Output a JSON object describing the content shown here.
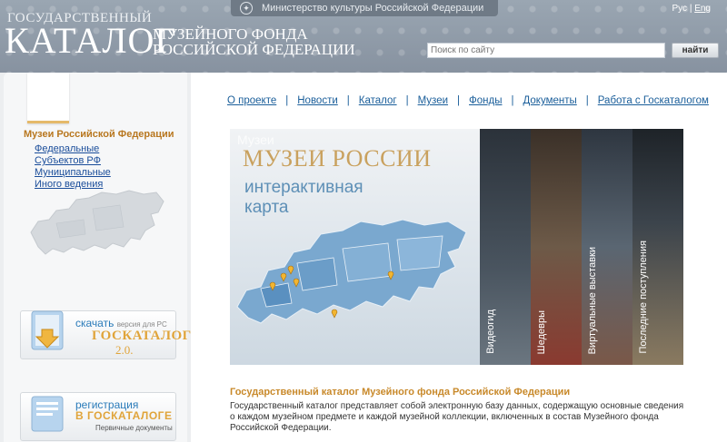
{
  "header": {
    "ministry": "Министерство культуры Российской Федерации",
    "lang_ru": "Рус",
    "lang_sep": "|",
    "lang_en": "Eng",
    "logo_small": "ГОСУДАРСТВЕННЫЙ",
    "logo_big": "КАТАЛОГ",
    "logo_sub1": "МУЗЕЙНОГО ФОНДА",
    "logo_sub2": "РОССИЙСКОЙ ФЕДЕРАЦИИ",
    "search_placeholder": "Поиск по сайту",
    "search_button": "найти"
  },
  "nav": {
    "items": [
      "О проекте",
      "Новости",
      "Каталог",
      "Музеи",
      "Фонды",
      "Документы",
      "Работа с Госкаталогом"
    ],
    "separator": "|"
  },
  "sidebar": {
    "title": "Музеи Российской Федерации",
    "items": [
      "Федеральные",
      "Субъектов РФ",
      "Муниципальные",
      "Иного ведения"
    ],
    "promo1": {
      "line1": "скачать",
      "line1_small": "версия для PC",
      "line2": "ГОСКАТАЛОГ",
      "line3": "2.0."
    },
    "promo2": {
      "line1": "регистрация",
      "line2": "В ГОСКАТАЛОГЕ",
      "line3": "Первичные документы"
    }
  },
  "banner": {
    "ghost": "Музеи",
    "title": "МУЗЕИ РОССИИ",
    "subtitle1": "интерактивная",
    "subtitle2": "карта",
    "strips": [
      "Видеогид",
      "Шедевры",
      "Виртуальные выставки",
      "Последние поступления"
    ]
  },
  "about": {
    "title": "Государственный каталог Музейного фонда Российской Федерации",
    "text": "Государственный каталог представляет собой электронную базу данных, содержащую основные сведения о каждом музейном предмете и каждой музейной коллекции, включенных в состав Музейного фонда Российской Федерации."
  },
  "colors": {
    "accent": "#1a5e9a",
    "gold": "#c8892a",
    "header": "#8a96a2"
  }
}
